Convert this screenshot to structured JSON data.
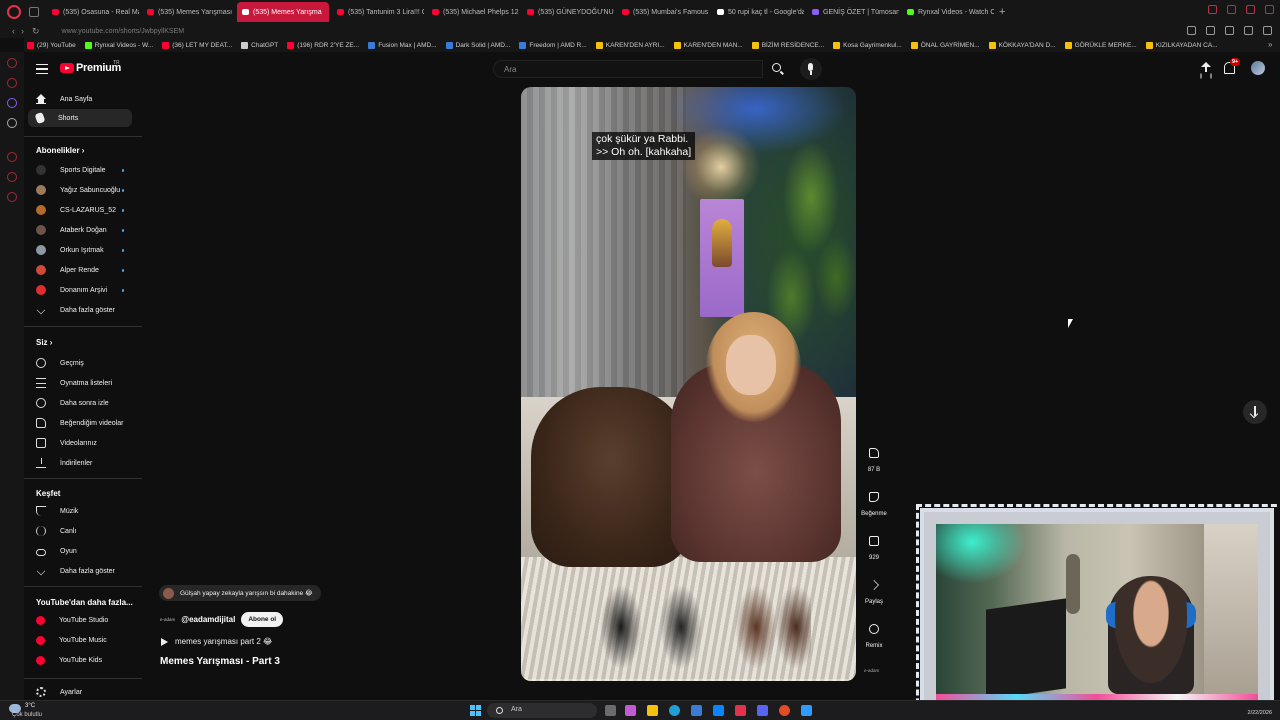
{
  "browser": {
    "tabs": [
      {
        "title": "(535) Osasuna - Real Mad",
        "color": "#ff0033",
        "active": false
      },
      {
        "title": "(535) Memes Yarışması",
        "color": "#ff0033",
        "active": false
      },
      {
        "title": "(535) Memes Yarışma",
        "color": "#ffffff",
        "active": true
      },
      {
        "title": "(535) Tantunim 3 Lira!!! G",
        "color": "#ff0033",
        "active": false
      },
      {
        "title": "(535) Michael Phelps 12,0",
        "color": "#ff0033",
        "active": false
      },
      {
        "title": "(535) GÜNEYDOĞU'NUN",
        "color": "#ff0033",
        "active": false
      },
      {
        "title": "(535) Mumbai's Famous",
        "color": "#ff0033",
        "active": false
      },
      {
        "title": "50 rupi kaç tl - Google'da",
        "color": "#ffffff",
        "active": false
      },
      {
        "title": "GENİŞ ÖZET | Tümosan K",
        "color": "#8b5cf6",
        "active": false
      },
      {
        "title": "Rynxal Videos - Watch On",
        "color": "#53fc18",
        "active": false
      }
    ],
    "new_tab": "+",
    "url": "www.youtube.com/shorts/JwbpyllKSEM",
    "bookmarks": [
      {
        "label": "(29) YouTube",
        "color": "#ff0033"
      },
      {
        "label": "Rynxal Videos - W...",
        "color": "#53fc18"
      },
      {
        "label": "(36) LET MY DEAT...",
        "color": "#ff0033"
      },
      {
        "label": "ChatGPT",
        "color": "#cccccc"
      },
      {
        "label": "(196) RDR 2'YE ZE...",
        "color": "#ff0033"
      },
      {
        "label": "Fusion Max | AMD...",
        "color": "#3a7bd5"
      },
      {
        "label": "Dark Solid | AMD...",
        "color": "#3a7bd5"
      },
      {
        "label": "Freedom | AMD R...",
        "color": "#3a7bd5"
      },
      {
        "label": "KAREN'DEN AYRI...",
        "color": "#f4c20d"
      },
      {
        "label": "KAREN'DEN MAN...",
        "color": "#f4c20d"
      },
      {
        "label": "BİZİM RESİDENCE...",
        "color": "#f4c20d"
      },
      {
        "label": "Kosa Gayrimenkul...",
        "color": "#f4c20d"
      },
      {
        "label": "ÖNAL GAYRİMEN...",
        "color": "#f4c20d"
      },
      {
        "label": "KÖKKAYA'DAN D...",
        "color": "#f4c20d"
      },
      {
        "label": "GÖRÜKLE MERKE...",
        "color": "#f4c20d"
      },
      {
        "label": "KIZILKAYADAN CA...",
        "color": "#f4c20d"
      }
    ],
    "bookmarks_more": "»"
  },
  "header": {
    "brand": "Premium",
    "brand_suffix": "TR",
    "search_placeholder": "Ara",
    "notification_badge": "9+"
  },
  "sidebar": {
    "main": [
      {
        "label": "Ana Sayfa",
        "icon": "home-icon"
      },
      {
        "label": "Shorts",
        "icon": "shorts-icon",
        "active": true
      }
    ],
    "subscriptions_title": "Abonelikler",
    "subscriptions": [
      {
        "label": "Sports Digitale",
        "color": "#333333"
      },
      {
        "label": "Yağız Sabuncuoğlu",
        "color": "#9b7b5a"
      },
      {
        "label": "CS-LAZARUS_52",
        "color": "#b36b2c"
      },
      {
        "label": "Ataberk Doğan",
        "color": "#6a5648"
      },
      {
        "label": "Orkun Işıtmak",
        "color": "#8d98a6"
      },
      {
        "label": "Alper Rende",
        "color": "#d04a3a"
      },
      {
        "label": "Donanım Arşivi",
        "color": "#e02d2d"
      }
    ],
    "show_more": "Daha fazla göster",
    "you_title": "Siz",
    "you_items": [
      {
        "label": "Geçmiş",
        "icon": "history-icon"
      },
      {
        "label": "Oynatma listeleri",
        "icon": "playlist-icon"
      },
      {
        "label": "Daha sonra izle",
        "icon": "watch-later-icon"
      },
      {
        "label": "Beğendiğim videolar",
        "icon": "liked-icon"
      },
      {
        "label": "Videolarınız",
        "icon": "your-videos-icon"
      },
      {
        "label": "İndirilenler",
        "icon": "downloads-icon"
      }
    ],
    "explore_title": "Keşfet",
    "explore_items": [
      {
        "label": "Müzik",
        "icon": "music-icon"
      },
      {
        "label": "Canlı",
        "icon": "live-icon"
      },
      {
        "label": "Oyun",
        "icon": "gaming-icon"
      }
    ],
    "show_more_2": "Daha fazla göster",
    "more_title": "YouTube'dan daha fazla...",
    "more_items": [
      {
        "label": "YouTube Studio"
      },
      {
        "label": "YouTube Music"
      },
      {
        "label": "YouTube Kids"
      }
    ],
    "settings": "Ayarlar"
  },
  "video": {
    "caption_line1": "çok şükür ya Rabbi.",
    "caption_line2": ">> Oh oh. [kahkaha]",
    "progress": 0.0,
    "top_comment": "Gülşah yapay zekayla yarışsın bi dahakine 😂",
    "channel_logo_text": "e-adam",
    "channel_handle": "@eadamdijital",
    "subscribe_label": "Abone ol",
    "playlist": "memes yarışması part 2 😂",
    "title": "Memes Yarışması - Part 3"
  },
  "actions": {
    "likes": "87 B",
    "dislike": "Beğenme",
    "comments": "929",
    "share": "Paylaş",
    "remix": "Remix",
    "channel_mini": "e-adam"
  },
  "taskbar": {
    "temperature": "3°C",
    "weather": "Çok bulutlu",
    "search": "Ara",
    "date": "2/22/2026"
  }
}
